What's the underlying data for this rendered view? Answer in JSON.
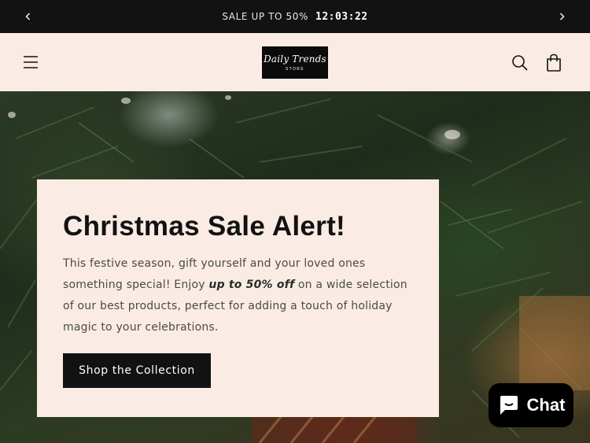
{
  "announcement": {
    "text": "SALE UP TO 50%",
    "countdown": "12:03:22",
    "prev_icon": "chevron-left-icon",
    "next_icon": "chevron-right-icon"
  },
  "header": {
    "menu_icon": "hamburger-menu-icon",
    "logo_line1": "Daily Trends",
    "logo_line2": "STORE",
    "search_icon": "search-icon",
    "cart_icon": "shopping-bag-icon"
  },
  "hero": {
    "title": "Christmas Sale Alert!",
    "body_before": "This festive season, gift yourself and your loved ones something special! Enjoy ",
    "body_emphasis": "up to 50% off",
    "body_after": " on a wide selection of our best products, perfect for adding a touch of holiday magic to your celebrations.",
    "cta_label": "Shop the Collection"
  },
  "chat": {
    "label": "Chat",
    "icon": "chat-bubble-icon"
  },
  "colors": {
    "announcement_bg": "#121212",
    "header_bg": "#faece4",
    "button_bg": "#121212",
    "chat_bg": "#000000"
  }
}
